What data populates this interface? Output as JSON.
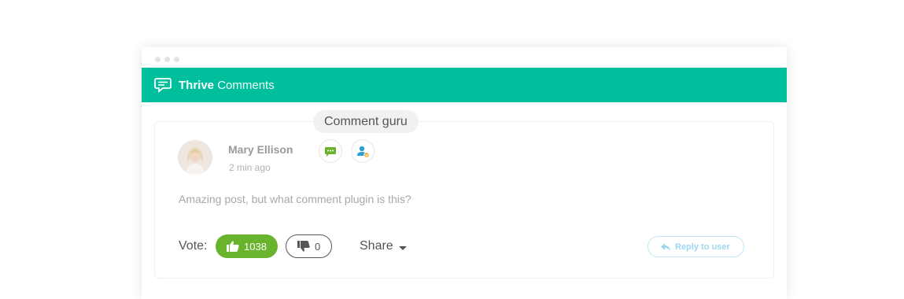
{
  "header": {
    "brand_strong": "Thrive",
    "brand_light": "Comments"
  },
  "comment": {
    "tooltip": "Comment guru",
    "author": "Mary Ellison",
    "time": "2 min ago",
    "text": "Amazing post, but what comment plugin is this?",
    "badges": [
      "comment-badge-icon",
      "user-badge-icon"
    ]
  },
  "actions": {
    "vote_label": "Vote:",
    "upvotes": "1038",
    "downvotes": "0",
    "share_label": "Share",
    "reply_label": "Reply to user"
  },
  "colors": {
    "header": "#00bf9c",
    "upvote": "#6ab42d",
    "reply": "#9fd6ef",
    "badge_green": "#6ab42d",
    "badge_blue": "#2d9cdb",
    "badge_orange": "#f5a623"
  }
}
